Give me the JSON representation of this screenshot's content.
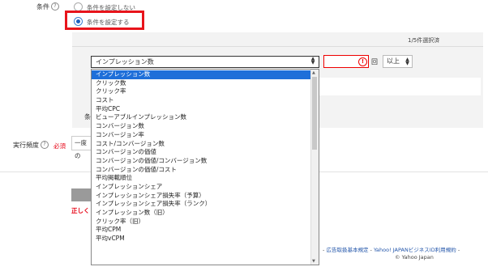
{
  "condition": {
    "label": "条件",
    "help": "?",
    "options": [
      "条件を設定しない",
      "条件を設定する"
    ],
    "selected_index": 1
  },
  "panel": {
    "count_text": "1/5件選択済",
    "metric_select_value": "インプレッション数",
    "times_label": "回",
    "operator_value": "以上",
    "dropdown_options": [
      "インプレッション数",
      "クリック数",
      "クリック率",
      "コスト",
      "平均CPC",
      "ビューアブルインプレッション数",
      "コンバージョン数",
      "コンバージョン率",
      "コスト/コンバージョン数",
      "コンバージョンの価値",
      "コンバージョンの価値/コンバージョン数",
      "コンバージョンの価値/コスト",
      "平均掲載順位",
      "インプレッションシェア",
      "インプレッションシェア損失率（予算）",
      "インプレッションシェア損失率（ランク）",
      "インプレッション数（旧）",
      "クリック率（旧）",
      "平均CPM",
      "平均vCPM"
    ],
    "dropdown_selected_index": 0,
    "partial_left_text": "条"
  },
  "frequency": {
    "label": "実行頻度",
    "help": "?",
    "required": "必須",
    "select_partial": "一度の"
  },
  "error_partial": "正しく",
  "footer": {
    "sep": "-",
    "link1": "広告取扱基本規定",
    "link2": "Yahoo! JAPANビジネスID利用規約",
    "trail": "- ",
    "copyright": "© Yahoo Japan"
  },
  "colors": {
    "highlight_box": "#e8141b",
    "selected_item_bg": "#1e6fd9",
    "required_text": "#e60012",
    "error_border": "#ee0000"
  }
}
